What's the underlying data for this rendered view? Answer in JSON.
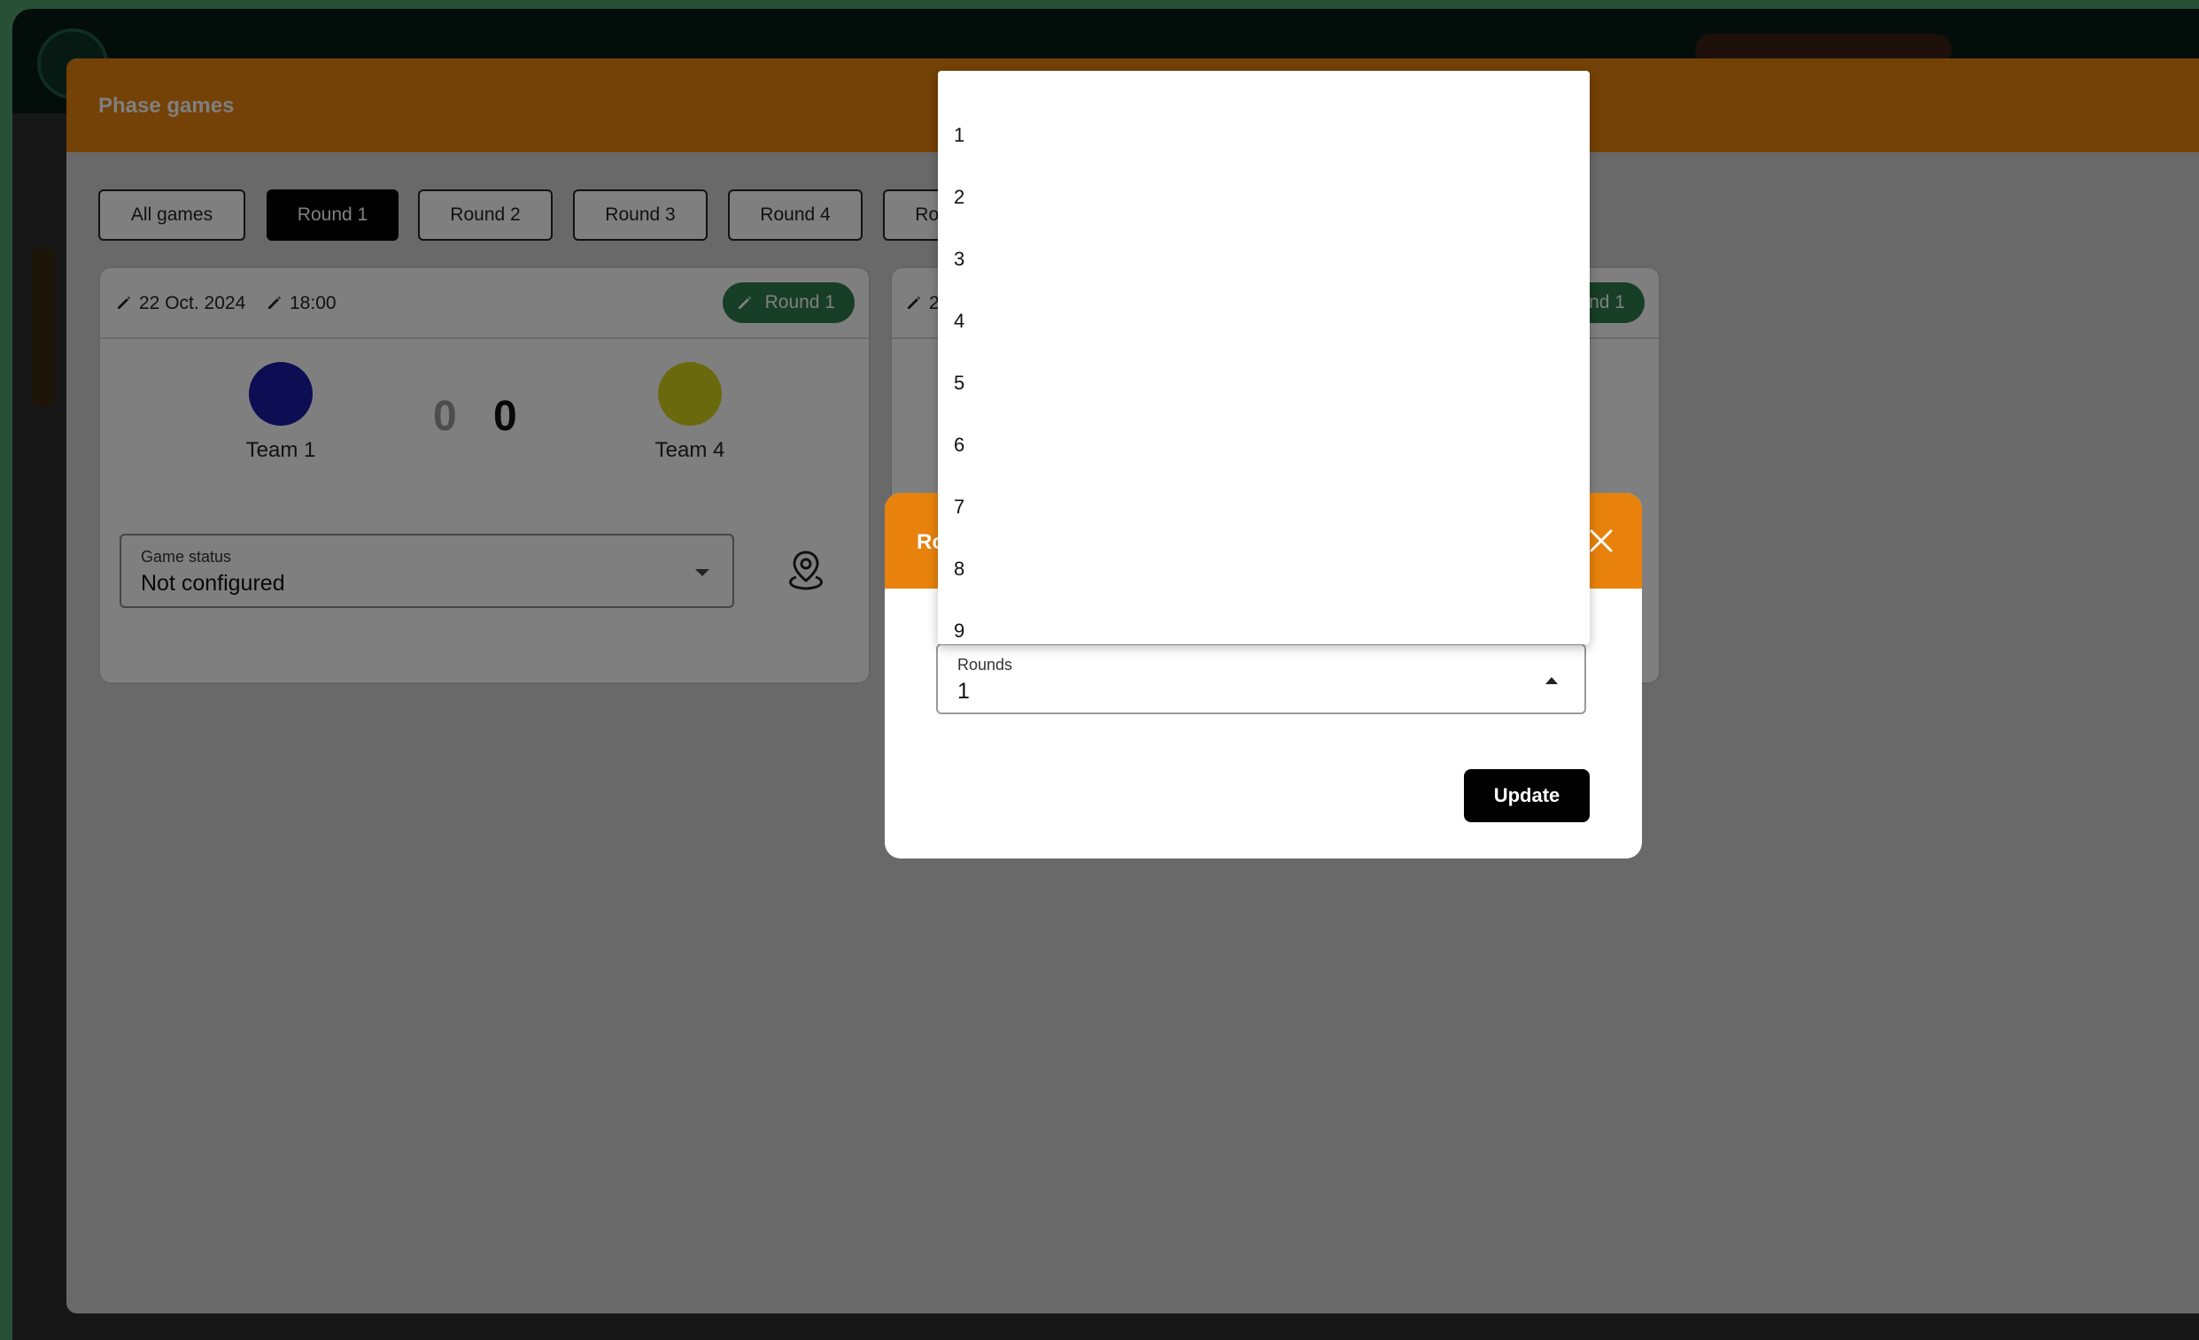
{
  "panel": {
    "title": "Phase games",
    "tabs": [
      "All games",
      "Round 1",
      "Round 2",
      "Round 3",
      "Round 4",
      "Round 5"
    ],
    "active_tab_index": 1
  },
  "card": {
    "date": "22 Oct. 2024",
    "time": "18:00",
    "round_badge": "Round 1",
    "home_team": {
      "name": "Team 1",
      "color": "#1a1aa6"
    },
    "away_team": {
      "name": "Team 4",
      "color": "#d6d21a"
    },
    "home_score": "0",
    "away_score": "0",
    "status_label": "Game status",
    "status_value": "Not configured"
  },
  "card2": {
    "date": "22",
    "round_badge": "Round 1"
  },
  "dialog": {
    "title": "Round",
    "field_label": "Rounds",
    "field_value": "1",
    "update_label": "Update",
    "accent_color": "#e8820c"
  },
  "menu": {
    "options": [
      "1",
      "2",
      "3",
      "4",
      "5",
      "6",
      "7",
      "8",
      "9"
    ]
  }
}
